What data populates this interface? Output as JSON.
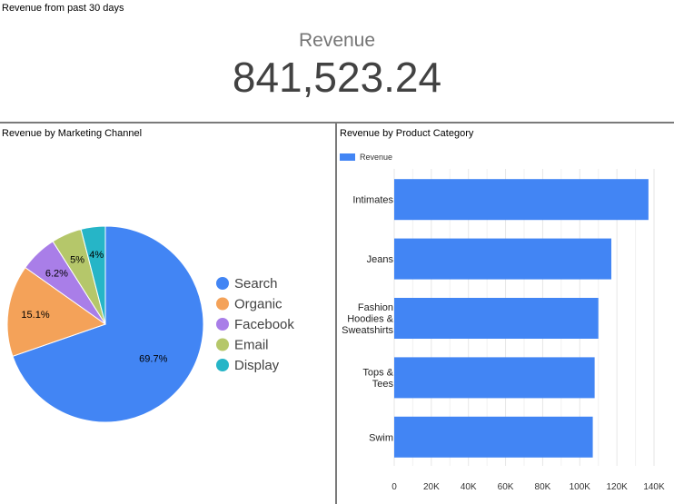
{
  "kpi": {
    "title": "Revenue from past 30 days",
    "label": "Revenue",
    "value": "841,523.24"
  },
  "colors": {
    "search": "#4285f4",
    "organic": "#f4a259",
    "facebook": "#a97ee8",
    "email": "#b5c76a",
    "display": "#26b5c7",
    "bar": "#4285f4",
    "divider": "#7a7a7a"
  },
  "chart_data": [
    {
      "type": "pie",
      "title": "Revenue by Marketing Channel",
      "labels": [
        "Search",
        "Organic",
        "Facebook",
        "Email",
        "Display"
      ],
      "values": [
        69.7,
        15.1,
        6.2,
        5,
        4
      ],
      "value_labels": [
        "69.7%",
        "15.1%",
        "6.2%",
        "5%",
        "4%"
      ],
      "legend_position": "right"
    },
    {
      "type": "bar",
      "orientation": "horizontal",
      "title": "Revenue by Product Category",
      "categories": [
        "Intimates",
        "Jeans",
        "Fashion Hoodies & Sweatshirts",
        "Tops & Tees",
        "Swim"
      ],
      "category_lines": [
        [
          "Intimates"
        ],
        [
          "Jeans"
        ],
        [
          "Fashion",
          "Hoodies &",
          "Sweatshirts"
        ],
        [
          "Tops &",
          "Tees"
        ],
        [
          "Swim"
        ]
      ],
      "series": [
        {
          "name": "Revenue",
          "values": [
            137000,
            117000,
            110000,
            108000,
            107000
          ]
        }
      ],
      "xlim": [
        0,
        140000
      ],
      "x_ticks": [
        "0",
        "20K",
        "40K",
        "60K",
        "80K",
        "100K",
        "120K",
        "140K"
      ],
      "grid": true,
      "legend_position": "top-left"
    }
  ]
}
